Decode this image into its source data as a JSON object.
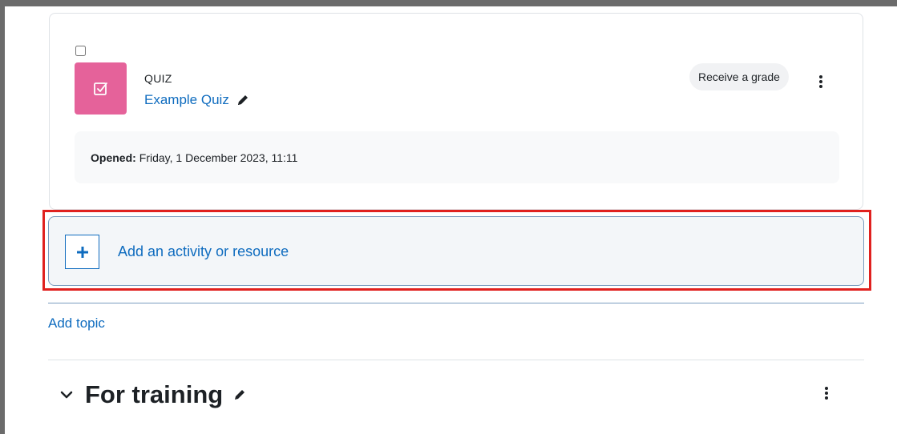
{
  "activity": {
    "type_label": "QUIZ",
    "name": "Example Quiz",
    "completion_badge": "Receive a grade",
    "dates": {
      "label": "Opened:",
      "value": "Friday, 1 December 2023, 11:11"
    },
    "icon": "quiz-icon",
    "icon_bg_color": "#e5629a"
  },
  "add_activity": {
    "label": "Add an activity or resource",
    "icon": "plus-icon"
  },
  "add_topic": {
    "label": "Add topic"
  },
  "section": {
    "title": "For training",
    "collapse_icon": "chevron-down-icon",
    "edit_icon": "pencil-icon"
  },
  "colors": {
    "link": "#0f6cbf",
    "highlight": "#e0211f",
    "text": "#1d2125"
  }
}
